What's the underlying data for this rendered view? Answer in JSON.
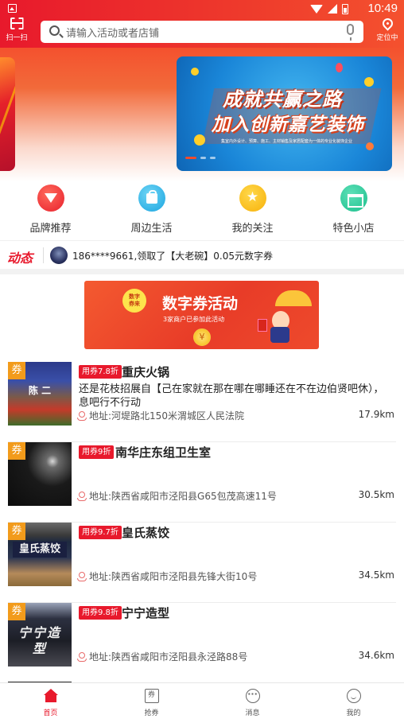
{
  "status_bar": {
    "time": "10:49"
  },
  "header": {
    "scan_label": "扫一扫",
    "search_placeholder": "请输入活动或者店铺",
    "locate_label": "定位中"
  },
  "banner": {
    "line1": "成就共赢之路",
    "line2": "加入创新嘉艺装饰",
    "subtitle": "集室内外设计、预算、施工、主材销售及家居配套为一体的专业化装饰企业",
    "active_slide": 1,
    "slide_count": 3
  },
  "categories": [
    {
      "label": "品牌推荐",
      "icon": "gem-icon"
    },
    {
      "label": "周边生活",
      "icon": "bag-icon"
    },
    {
      "label": "我的关注",
      "icon": "star-icon"
    },
    {
      "label": "特色小店",
      "icon": "shop-icon"
    }
  ],
  "ticker": {
    "title": "动态",
    "text": "186****9661,领取了【大老碗】0.05元数字券"
  },
  "promo": {
    "badge": "数字\n券来",
    "title": "数字券活动",
    "subtitle": "3家商户已参加此活动"
  },
  "stores": [
    {
      "tag": "券",
      "coupon": "用券7.8折",
      "name": "重庆火锅",
      "description": "还是花枝招展自【己在家就在那在哪在哪睡还在不在边伯贤吧休），息吧行不行动",
      "address": "地址:河堤路北150米渭城区人民法院",
      "distance": "17.9km",
      "sign": "陈 二"
    },
    {
      "tag": "券",
      "coupon": "用券9折",
      "name": "南华庄东组卫生室",
      "description": "",
      "address": "地址:陕西省咸阳市泾阳县G65包茂高速11号",
      "distance": "30.5km",
      "sign": ""
    },
    {
      "tag": "券",
      "coupon": "用券9.7折",
      "name": "皇氏蒸饺",
      "description": "",
      "address": "地址:陕西省咸阳市泾阳县先锋大街10号",
      "distance": "34.5km",
      "sign": "皇氏蒸饺"
    },
    {
      "tag": "券",
      "coupon": "用券9.8折",
      "name": "宁宁造型",
      "description": "",
      "address": "地址:陕西省咸阳市泾阳县永泾路88号",
      "distance": "34.6km",
      "sign": "宁宁造型"
    }
  ],
  "tabs": [
    {
      "label": "首页",
      "icon": "home-icon",
      "active": true
    },
    {
      "label": "抢券",
      "icon": "coupon-icon",
      "active": false
    },
    {
      "label": "消息",
      "icon": "message-icon",
      "active": false
    },
    {
      "label": "我的",
      "icon": "profile-icon",
      "active": false
    }
  ],
  "colors": {
    "brand": "#e8192c",
    "coupon_tag": "#f29b1b",
    "active_tab": "#e8192c"
  }
}
